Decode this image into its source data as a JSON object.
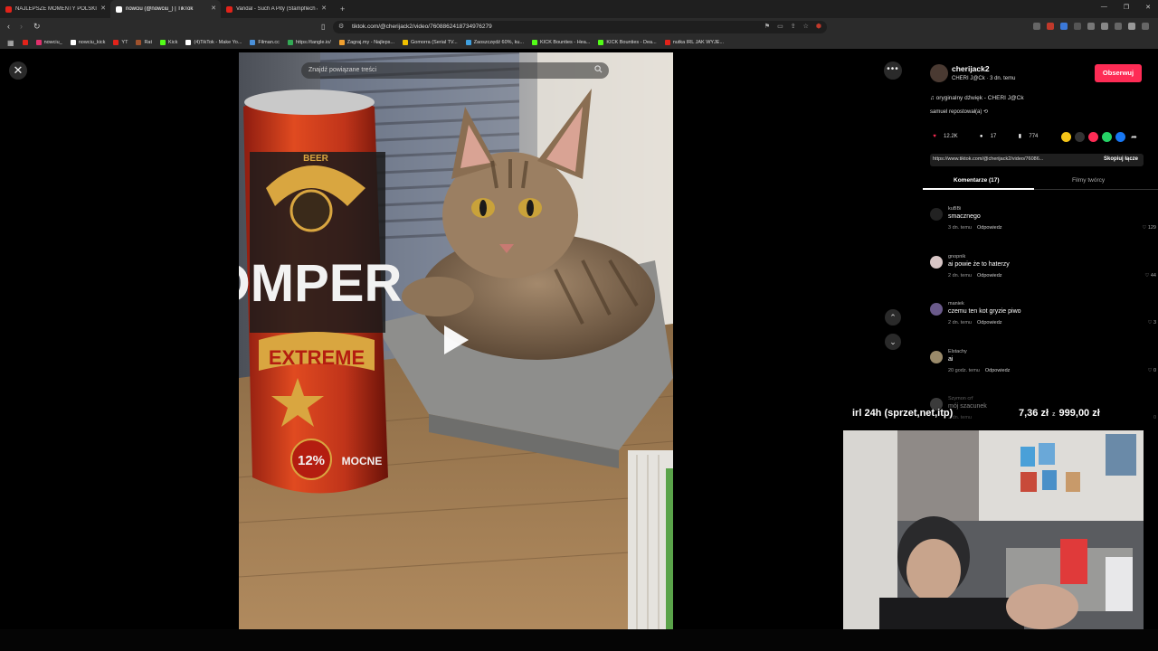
{
  "browser": {
    "tabs": [
      {
        "title": "NAJLEPSZE MOMENTY POLSKI",
        "active": false,
        "favicon_color": "#e2231a"
      },
      {
        "title": "nowciu (@nowciu_) | TikTok",
        "active": true,
        "favicon_color": "#ffffff"
      },
      {
        "title": "Vandal - Such A Pity (Stampflech &",
        "active": false,
        "favicon_color": "#e2231a"
      }
    ],
    "new_tab": "+",
    "url": "tiktok.com/@cherijack2/video/7608862418734976279",
    "bookmarks": [
      {
        "label": "nowciu_",
        "color": "#e1306c"
      },
      {
        "label": "nowciu_kick",
        "color": "#ffffff"
      },
      {
        "label": "YT",
        "color": "#e2231a"
      },
      {
        "label": "Rat",
        "color": "#a0522d"
      },
      {
        "label": "Kick",
        "color": "#53fc18"
      },
      {
        "label": "(4)TikTok - Make Yo...",
        "color": "#ffffff"
      },
      {
        "label": "Filman.cc",
        "color": "#4a90d9"
      },
      {
        "label": "https://tangle.io/",
        "color": "#33aa55"
      },
      {
        "label": "Zagraj.my - Najleps...",
        "color": "#f0a030"
      },
      {
        "label": "Gomorra (Serial TV...",
        "color": "#f0c000"
      },
      {
        "label": "Zaoszczędź 60%, ku...",
        "color": "#3fa0e0"
      },
      {
        "label": "KICK Bounties - Hea...",
        "color": "#53fc18"
      },
      {
        "label": "KICK Bounties - Dea...",
        "color": "#53fc18"
      },
      {
        "label": "nutka IRL JAK WYJE...",
        "color": "#e2231a"
      }
    ]
  },
  "video": {
    "search_placeholder": "Znajdź powiązane treści",
    "can_text_line1": "OMPER",
    "can_text_line2": "EXTREME",
    "can_percent": "12%",
    "can_text_mocne": "MOCNE",
    "can_text_top": "BEER"
  },
  "panel": {
    "author": "cherijack2",
    "author_sub": "CHERI J@Ck · 3 dn. temu",
    "follow": "Obserwuj",
    "music": "♫ oryginalny dźwięk - CHERI J@Ck",
    "repost": "samuel repostował(a)",
    "likes": "12.2K",
    "comments": "17",
    "saves": "774",
    "link": "https://www.tiktok.com/@cherijack2/video/76086...",
    "copy_link": "Skopiuj łącze",
    "tab_comments": "Komentarze (17)",
    "tab_creator": "Filmy twórcy",
    "reply_label": "Odpowiedz",
    "comment_list": [
      {
        "user": "kuBBi",
        "text": "smacznego",
        "time": "3 dn. temu",
        "likes": "129",
        "color": "#222222"
      },
      {
        "user": "gnopnik",
        "text": "ai powie że to haterzy",
        "time": "2 dn. temu",
        "likes": "44",
        "color": "#d8c6c6"
      },
      {
        "user": "maniek",
        "text": "czemu ten kot gryzie piwo",
        "time": "2 dn. temu",
        "likes": "3",
        "color": "#6a5a8a"
      },
      {
        "user": "Elstachy",
        "text": "ai",
        "time": "20 godz. temu",
        "likes": "0",
        "color": "#9a8a6a"
      },
      {
        "user": "Szymon crf",
        "text": "mój szacunek",
        "time": "2 dn. temu",
        "likes": "0",
        "color": "#777777"
      }
    ]
  },
  "stream": {
    "donation_label": "irl 24h (sprzet,net,itp)",
    "donation_current": "7,36 zł",
    "donation_sep": "z",
    "donation_goal": "999,00 zł"
  },
  "colors": {
    "accent": "#fe2c55",
    "panel_bg": "#000000",
    "chrome_bg": "#2b2b2b"
  }
}
